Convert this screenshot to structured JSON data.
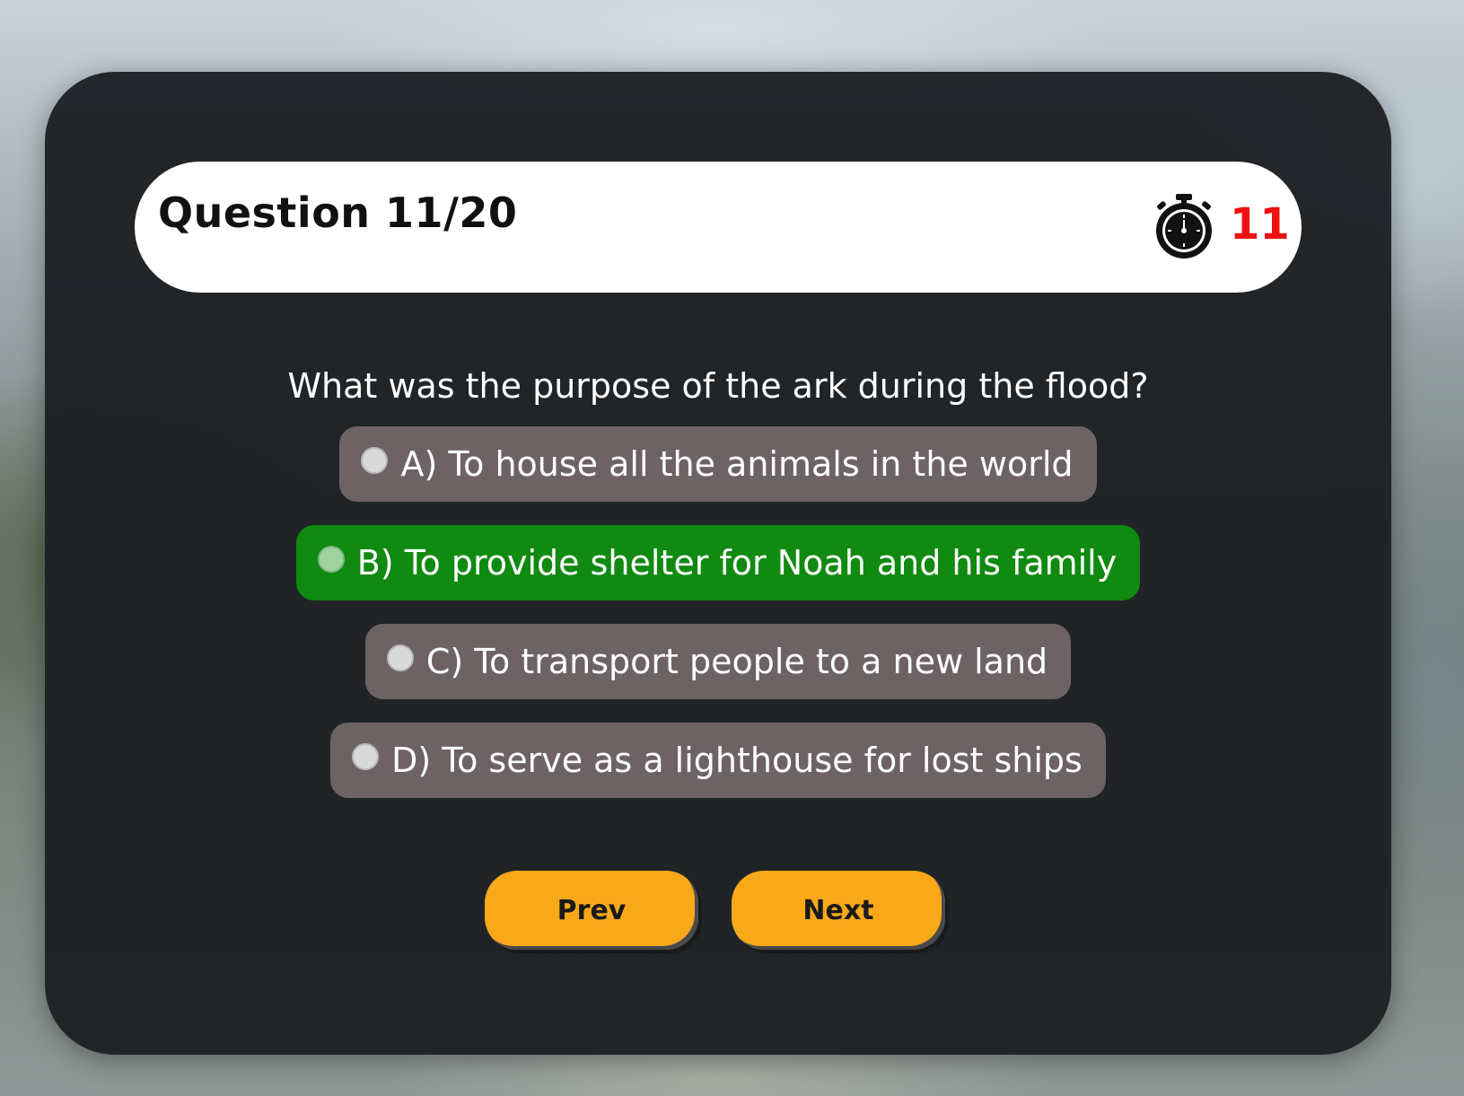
{
  "header": {
    "question_counter": "Question 11/20",
    "timer_value": "11",
    "timer_icon": "stopwatch-icon"
  },
  "question": {
    "text": "What was the purpose of the ark during the flood?"
  },
  "options": [
    {
      "label": "A) To house all the animals in the world",
      "selected": false
    },
    {
      "label": "B) To provide shelter for Noah and his family",
      "selected": true
    },
    {
      "label": "C) To transport people to a new land",
      "selected": false
    },
    {
      "label": "D) To serve as a lighthouse for lost ships",
      "selected": false
    }
  ],
  "navigation": {
    "prev_label": "Prev",
    "next_label": "Next"
  },
  "colors": {
    "card_background": "#1e2124",
    "option_background": "#6e6364",
    "selected_option_background": "#108a10",
    "button_background": "#f9a81a",
    "timer_color": "#ee1111"
  }
}
